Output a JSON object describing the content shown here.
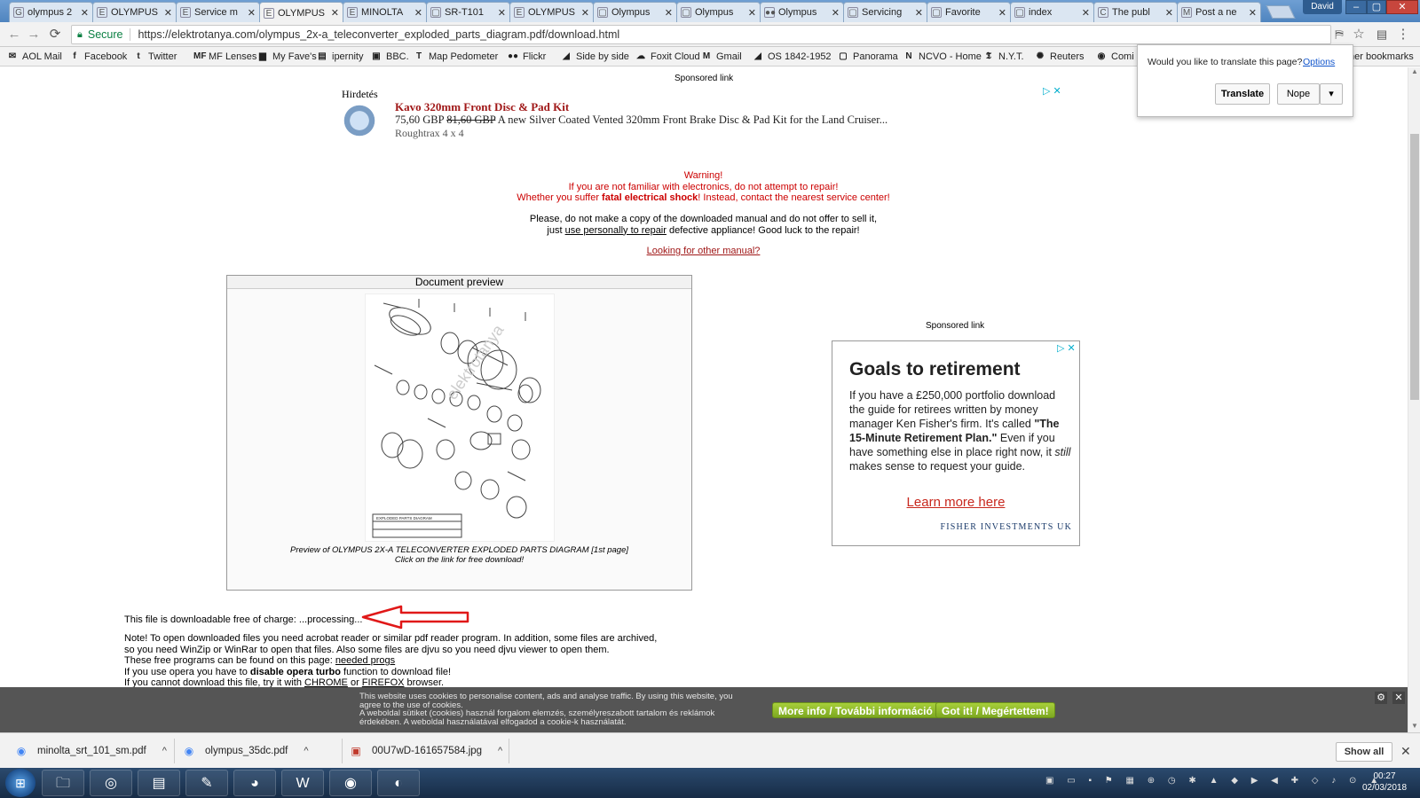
{
  "tabs": [
    {
      "icon": "G",
      "label": "olympus 2"
    },
    {
      "icon": "E",
      "label": "OLYMPUS"
    },
    {
      "icon": "E",
      "label": "Service m"
    },
    {
      "icon": "E",
      "label": "OLYMPUS",
      "active": true
    },
    {
      "icon": "E",
      "label": "MINOLTA"
    },
    {
      "icon": "▢",
      "label": "SR-T101"
    },
    {
      "icon": "E",
      "label": "OLYMPUS"
    },
    {
      "icon": "▢",
      "label": "Olympus"
    },
    {
      "icon": "▢",
      "label": "Olympus"
    },
    {
      "icon": "●●",
      "label": "Olympus"
    },
    {
      "icon": "▢",
      "label": "Servicing"
    },
    {
      "icon": "▢",
      "label": "Favorite"
    },
    {
      "icon": "▢",
      "label": "index"
    },
    {
      "icon": "C",
      "label": "The publ"
    },
    {
      "icon": "M",
      "label": "Post a ne"
    }
  ],
  "window": {
    "user": "David",
    "minimize": "–",
    "maximize": "▢",
    "close": "✕"
  },
  "toolbar": {
    "back": "←",
    "forward": "→",
    "reload": "⟳",
    "secure_label": "Secure",
    "url": "https://elektrotanya.com/olympus_2x-a_teleconverter_exploded_parts_diagram.pdf/download.html",
    "translate_icon": "⛿",
    "star_icon": "☆",
    "ext_icon": "▤",
    "menu_icon": "⋮"
  },
  "bookmarks": [
    {
      "icon": "✉",
      "label": "AOL Mail"
    },
    {
      "icon": "f",
      "label": "Facebook"
    },
    {
      "icon": "t",
      "label": "Twitter"
    },
    {
      "icon": "MF",
      "label": "MF Lenses"
    },
    {
      "icon": "▆",
      "label": "My Fave's"
    },
    {
      "icon": "▤",
      "label": "ipernity"
    },
    {
      "icon": "▣",
      "label": "BBC."
    },
    {
      "icon": "T",
      "label": "Map Pedometer"
    },
    {
      "icon": "●●",
      "label": "Flickr"
    },
    {
      "icon": "◢",
      "label": "Side by side"
    },
    {
      "icon": "☁",
      "label": "Foxit Cloud"
    },
    {
      "icon": "M",
      "label": "Gmail"
    },
    {
      "icon": "◢",
      "label": "OS 1842-1952"
    },
    {
      "icon": "▢",
      "label": "Panorama"
    },
    {
      "icon": "N",
      "label": "NCVO - Home"
    },
    {
      "icon": "𝕿",
      "label": "N.Y.T."
    },
    {
      "icon": "✺",
      "label": "Reuters"
    },
    {
      "icon": "◉",
      "label": "Comi"
    }
  ],
  "bookmarks_other": "her bookmarks",
  "translate_popup": {
    "question": "Would you like to translate this page?",
    "options": "Options",
    "translate": "Translate",
    "nope": "Nope",
    "dropdown": "▾"
  },
  "ad_top": {
    "sponsored": "Sponsored link",
    "label": "Hirdetés",
    "title": "Kavo 320mm Front Disc & Pad Kit",
    "price": "75,60 GBP",
    "old_price": "81,60 GBP",
    "description": "A new Silver Coated Vented 320mm Front Brake Disc & Pad Kit for the Land Cruiser...",
    "source": "Roughtrax 4 x 4",
    "adchoice": "▷ ✕"
  },
  "warning": {
    "line1": "Warning!",
    "line2": "If you are not familiar with electronics, do not attempt to repair!",
    "line3_pre": "Whether you suffer ",
    "line3_bold": "fatal electrical shock",
    "line3_post": "! Instead, contact the nearest service center!"
  },
  "please": {
    "line1": "Please, do not make a copy of the downloaded manual and do not offer to sell it,",
    "line2_pre": "just ",
    "line2_link": "use personally to repair",
    "line2_post": " defective appliance! Good luck to the repair!"
  },
  "other_manual": "Looking for other manual?",
  "preview": {
    "header": "Document preview",
    "caption1": "Preview of OLYMPUS 2X-A TELECONVERTER EXPLODED PARTS DIAGRAM [1st page]",
    "caption2": "Click on the link for free download!",
    "doc_title": "EXPLODED PARTS DIAGRAM"
  },
  "ad_right": {
    "sponsored": "Sponsored link",
    "adchoice": "▷ ✕",
    "headline": "Goals to retirement",
    "body_pre": "If you have a £250,000 portfolio download the guide for retirees written by money manager Ken Fisher's firm. It's called ",
    "body_bold": "\"The 15-Minute Retirement Plan.\"",
    "body_mid": " Even if you have something else in place right now, it ",
    "body_italic": "still",
    "body_post": " makes sense to request your guide.",
    "cta": "Learn more here",
    "brand": "FISHER INVESTMENTS UK"
  },
  "download": {
    "text": "This file is downloadable free of charge:",
    "status": "...processing..."
  },
  "note": {
    "l1": "Note! To open downloaded files you need acrobat reader or similar pdf reader program. In addition, some files are archived,",
    "l2": "so you need WinZip or WinRar to open that files. Also some files are djvu so you need djvu viewer to open them.",
    "l3_pre": "These free programs can be found on this page: ",
    "l3_link": "needed progs",
    "l4_pre": "If you use opera you have to ",
    "l4_bold": "disable opera turbo",
    "l4_post": " function to download file!",
    "l5_pre": "If you cannot download this file, try it with ",
    "l5_link1": "CHROME",
    "l5_mid": " or ",
    "l5_link2": "FIREFOX",
    "l5_post": " browser."
  },
  "cookie": {
    "text_en": "This website uses cookies to personalise content, ads and analyse traffic. By using this website, you agree to the use of cookies.",
    "text_hu": "A weboldal sütiket (cookies) használ forgalom elemzés, személyreszabott tartalom és reklámok érdekében. A weboldal használatával elfogadod a cookie-k használatát.",
    "more_info": "More info / További információ",
    "got_it": "Got it! / Megértettem!",
    "gear": "⚙",
    "close": "✕"
  },
  "downloads": [
    {
      "icon": "◉",
      "name": "minolta_srt_101_sm.pdf"
    },
    {
      "icon": "◉",
      "name": "olympus_35dc.pdf"
    },
    {
      "icon": "▣",
      "name": "00U7wD-161657584.jpg"
    }
  ],
  "downloads_chevron": "^",
  "downloads_show_all": "Show all",
  "downloads_close": "✕",
  "taskbar": {
    "start": "⊞",
    "apps": [
      "🗀",
      "◎",
      "▤",
      "✎",
      "◕",
      "W",
      "◉",
      "◐"
    ],
    "tray": "▣ ▭ ▪ ⚑ ▦ ⊕ ◷ ✱ ▲ ◆ ▶ ◀ ✚ ◇ ♪ ⊙ ▲",
    "time": "00:27",
    "date": "02/03/2018"
  },
  "colors": {
    "warning": "#cc0000",
    "link": "#a01818",
    "cookie_btn": "#8ab52a",
    "secure": "#0b8043"
  }
}
